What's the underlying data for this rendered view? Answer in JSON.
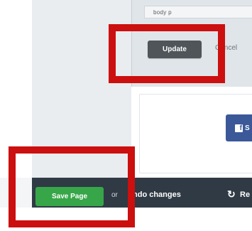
{
  "editor": {
    "status_path": "body  p",
    "update_label": "Update",
    "cancel_label": "Cancel"
  },
  "social": {
    "facebook_icon": "f",
    "facebook_label": "S"
  },
  "bottom_bar": {
    "save_label": "Save Page",
    "or_text": "or",
    "undo_label": "ndo changes",
    "reload_label": "Re"
  },
  "colors": {
    "highlight": "#cc0f0f",
    "save_green": "#37a649",
    "update_dark": "#4f5559",
    "facebook_blue": "#3b5998",
    "bar_bg": "#2f3a44"
  },
  "icons": {
    "reload": "reload-icon",
    "facebook": "facebook-icon"
  }
}
